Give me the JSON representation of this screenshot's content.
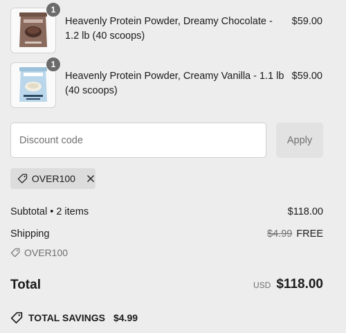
{
  "items": [
    {
      "quantity": "1",
      "name": "Heavenly Protein Powder, Dreamy Chocolate - 1.2 lb (40 scoops)",
      "price": "$59.00",
      "thumb_color": "#8a6a5c"
    },
    {
      "quantity": "1",
      "name": "Heavenly Protein Powder, Creamy Vanilla - 1.1 lb (40 scoops)",
      "price": "$59.00",
      "thumb_color": "#b9d6ea"
    }
  ],
  "discount": {
    "placeholder": "Discount code",
    "apply_label": "Apply",
    "applied_code": "OVER100"
  },
  "summary": {
    "subtotal_label": "Subtotal • 2 items",
    "subtotal_value": "$118.00",
    "shipping_label": "Shipping",
    "shipping_original": "$4.99",
    "shipping_value": "FREE",
    "shipping_code": "OVER100",
    "total_label": "Total",
    "currency": "USD",
    "total_value": "$118.00",
    "savings_label": "TOTAL SAVINGS",
    "savings_value": "$4.99"
  }
}
